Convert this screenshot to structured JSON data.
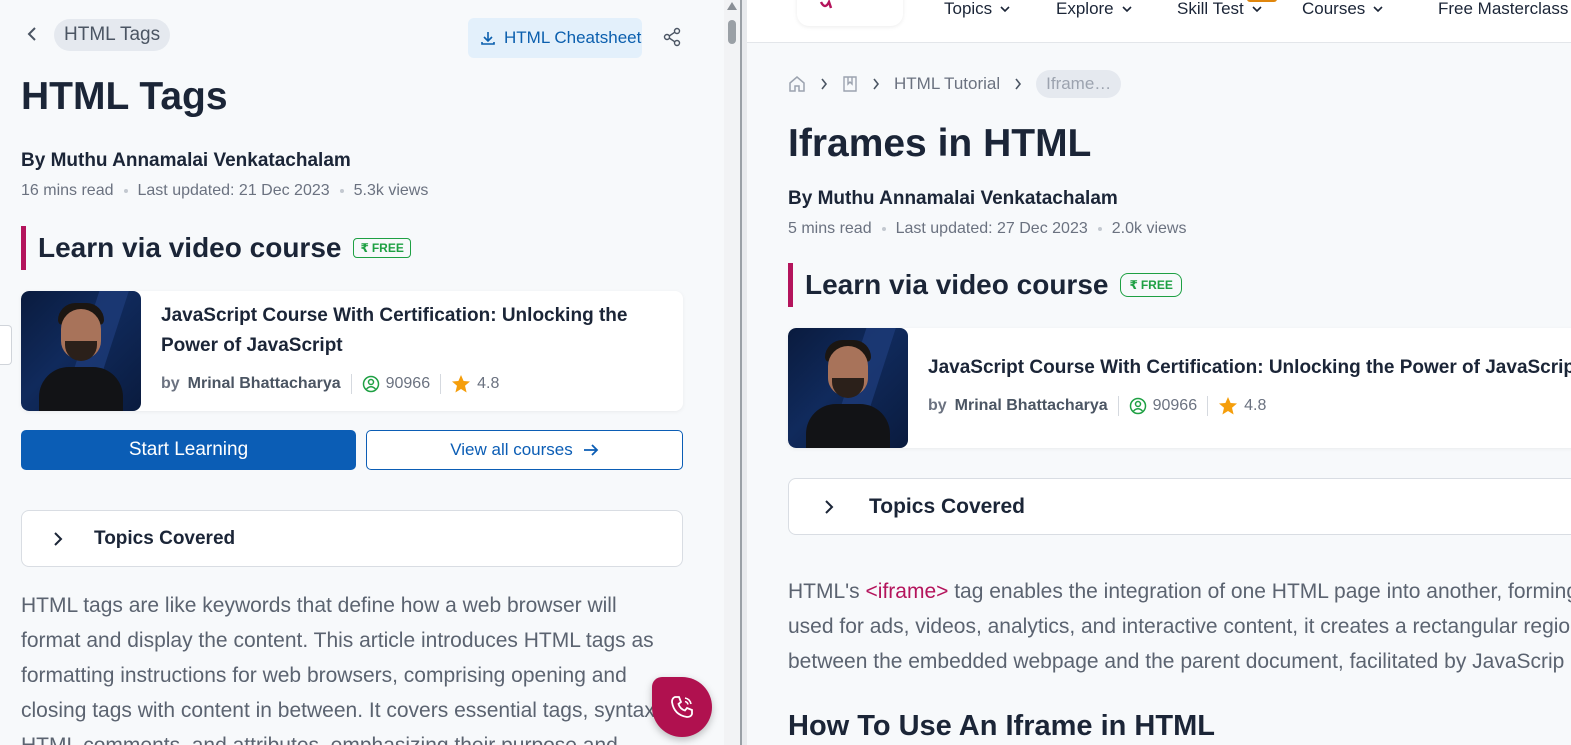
{
  "left": {
    "breadcrumb": "HTML Tags",
    "cheatsheet_label": "HTML Cheatsheet",
    "title": "HTML Tags",
    "author": "By Muthu Annamalai Venkatachalam",
    "read_time": "16 mins read",
    "updated": "Last updated: 21 Dec 2023",
    "views": "5.3k views",
    "learn_heading": "Learn via video course",
    "free_label": "FREE",
    "course": {
      "title_line1": "JavaScript Course With Certification: Unlocking the",
      "title_line2": "Power of JavaScript",
      "by": "by",
      "instructor": "Mrinal Bhattacharya",
      "learners": "90966",
      "rating": "4.8"
    },
    "start_label": "Start Learning",
    "view_all_label": "View all courses",
    "topics_label": "Topics Covered",
    "body": "HTML tags are like keywords that define how a web browser will format and display the content. This article introduces HTML tags as formatting instructions for web browsers, comprising opening and closing tags with content in between. It covers essential tags, syntax, HTML comments, and attributes, emphasizing their purpose and"
  },
  "right": {
    "nav": {
      "topics": "Topics",
      "explore": "Explore",
      "skill_test": "Skill Test",
      "courses": "Courses",
      "masterclass": "Free Masterclass"
    },
    "breadcrumb": {
      "tutorial": "HTML Tutorial",
      "current": "Iframe…"
    },
    "title": "Iframes in HTML",
    "author": "By Muthu Annamalai Venkatachalam",
    "read_time": "5 mins read",
    "updated": "Last updated: 27 Dec 2023",
    "views": "2.0k views",
    "learn_heading": "Learn via video course",
    "free_label": "FREE",
    "course": {
      "title": "JavaScript Course With Certification: Unlocking the Power of JavaScript",
      "by": "by",
      "instructor": "Mrinal Bhattacharya",
      "learners": "90966",
      "rating": "4.8"
    },
    "topics_label": "Topics Covered",
    "body_line1_pre": "HTML's ",
    "body_tag": "<iframe>",
    "body_line1_post": " tag enables the integration of one HTML page into another, forming",
    "body_line2": "used for ads, videos, analytics, and interactive content, it creates a rectangular regio",
    "body_line3": "between the embedded webpage and the parent document, facilitated by JavaScrip",
    "h2": "How To Use An Iframe in HTML"
  },
  "colors": {
    "accent_blue": "#0b5db5",
    "brand_magenta": "#b4145c",
    "free_green": "#1ea043",
    "star": "#f59e0b"
  },
  "icons": [
    "chevron-left-icon",
    "download-icon",
    "share-icon",
    "rupee-icon",
    "learners-icon",
    "star-icon",
    "arrow-right-icon",
    "chevron-right-icon",
    "home-icon",
    "book-icon",
    "chevron-down-icon",
    "phone-icon"
  ]
}
